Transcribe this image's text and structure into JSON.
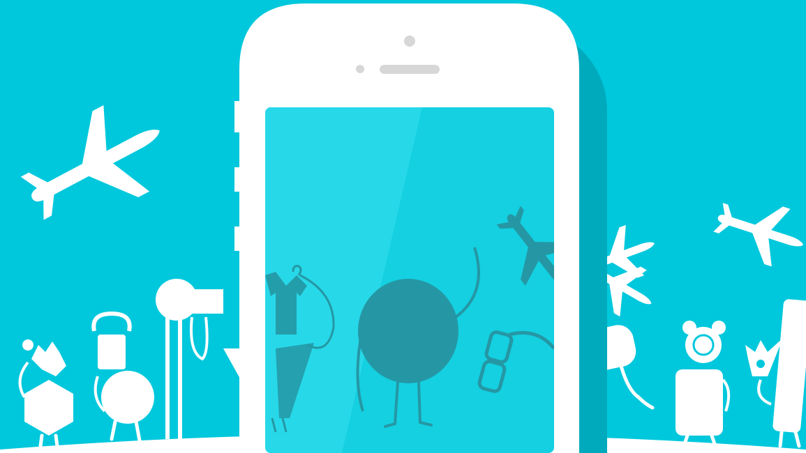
{
  "colors": {
    "background": "#00c8dc",
    "foreground": "#ffffff",
    "phone_shadow": "#00aabd",
    "screen": "#14d0e1",
    "screen_glare": "#27d8e8",
    "screen_characters": "#2597a4"
  },
  "scene": {
    "left_characters": [
      "robot-toy-icon",
      "camera-icon",
      "lamp-icon"
    ],
    "right_characters": [
      "alarm-clock-icon",
      "helmet-icon",
      "stick-figure-icon"
    ],
    "airplanes": [
      "airplane-icon-left",
      "airplane-icon-right-top",
      "airplane-icon-right-mid",
      "airplane-icon-screen"
    ],
    "screen_characters": [
      "shirt-on-hanger-icon",
      "oval-character-icon",
      "glasses-icon"
    ]
  }
}
